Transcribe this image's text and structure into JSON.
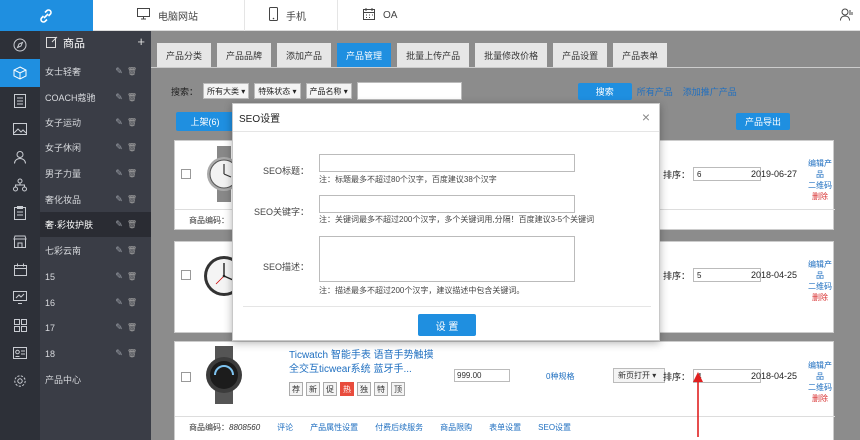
{
  "topbar": {
    "nav": [
      {
        "label": "电脑网站",
        "icon": "desktop-icon"
      },
      {
        "label": "手机",
        "icon": "phone-icon"
      },
      {
        "label": "OA",
        "icon": "calendar-icon"
      }
    ],
    "user_icon": "user-icon"
  },
  "rail": {
    "icons": [
      "compass-icon",
      "cube-icon",
      "document-icon",
      "image-icon",
      "user-icon",
      "org-chart-icon",
      "clipboard-icon",
      "store-icon",
      "calendar-icon",
      "monitor-chart-icon",
      "grid-icon",
      "id-card-icon",
      "settings-icon"
    ],
    "active_index": 1
  },
  "category": {
    "title": "商品",
    "add": "+",
    "items": [
      {
        "label": "女士轻奢"
      },
      {
        "label": "COACH蔻驰"
      },
      {
        "label": "女子运动"
      },
      {
        "label": "女子休闲"
      },
      {
        "label": "男子力量"
      },
      {
        "label": "奢化妆品"
      },
      {
        "label": "奢·彩妆护肤"
      },
      {
        "label": "七彩云南"
      },
      {
        "label": "15"
      },
      {
        "label": "16"
      },
      {
        "label": "17"
      },
      {
        "label": "18"
      },
      {
        "label": "产品中心"
      }
    ],
    "active_index": 6
  },
  "tabs": [
    {
      "label": "产品分类"
    },
    {
      "label": "产品品牌"
    },
    {
      "label": "添加产品"
    },
    {
      "label": "产品管理",
      "active": true
    },
    {
      "label": "批量上传产品"
    },
    {
      "label": "批量修改价格"
    },
    {
      "label": "产品设置"
    },
    {
      "label": "产品表单"
    }
  ],
  "filter": {
    "label": "搜索：",
    "sel1": "所有大类",
    "sel2": "特殊状态",
    "sel3": "产品名称",
    "search_btn": "搜索",
    "all_link": "所有产品",
    "promo_link": "添加推广产品"
  },
  "list": {
    "up_btn": "上架(6)",
    "export_btn": "产品导出",
    "sort_label": "排序：",
    "rows": [
      {
        "sort": "6",
        "date": "2019-06-27",
        "op1": "编辑产品",
        "op2": "二维码",
        "op3": "删除"
      },
      {
        "sort": "5",
        "date": "2018-04-25",
        "op1": "编辑产品",
        "op2": "二维码",
        "op3": "删除"
      },
      {
        "sort": "4",
        "date": "2018-04-25",
        "op1": "编辑产品",
        "op2": "二维码",
        "op3": "删除",
        "title": "Ticwatch 智能手表 语音手势触摸全交互ticwear系统 蓝牙手...",
        "tags": [
          "荐",
          "新",
          "促",
          "热",
          "独",
          "特",
          "顶"
        ],
        "price": "999.00",
        "category": "0种规格",
        "open": "新页打开"
      }
    ],
    "row1_code": "商品编码：",
    "footer": {
      "code_label": "商品编码：",
      "code": "8808560",
      "links": [
        "评论",
        "产品属性设置",
        "付费后续服务",
        "商品限购",
        "表单设置",
        "SEO设置"
      ]
    }
  },
  "modal": {
    "title": "SEO设置",
    "close": "×",
    "seo_title_label": "SEO标题：",
    "seo_title_note": "注：标题最多不超过80个汉字，百度建议38个汉字",
    "seo_keywords_label": "SEO关键字：",
    "seo_keywords_note": "注：关键词最多不超过200个汉字，多个关键词用,分隔！百度建议3-5个关键词",
    "seo_desc_label": "SEO描述：",
    "seo_desc_note": "注：描述最多不超过200个汉字，建议描述中包含关键词。",
    "submit": "设 置"
  },
  "colors": {
    "accent": "#1f8fe0",
    "rail_bg": "#2d3038",
    "sidebar_bg": "#3a3d46",
    "overlay": "#8c8c8c",
    "delete": "#d83030",
    "hot_tag": "#e84c3d"
  }
}
